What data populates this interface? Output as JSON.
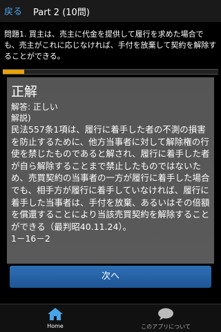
{
  "header": {
    "back_label": "戻る",
    "title": "Part 2 (10問)"
  },
  "question": {
    "text": "問題1. 買主は、売主に代金を提供して履行を求めた場合でも、売主がこれに応じなければ、手付を放棄して契約を解除することができる。"
  },
  "progress": {
    "fraction": 0.1
  },
  "result": {
    "verdict": "正解",
    "answer": "解答: 正しい",
    "explanation_label": "解説)",
    "explanation": "民法557条1項は、履行に着手した者の不測の損害を防止するために、他方当事者に対して解除権の行使を禁じたものであると解され、履行に着手した者が自ら解除することまで禁止したものではないため、売買契約の当事者の一方が履行に着手した場合でも、相手方が履行に着手していなければ、履行に着手した当事者は、手付を放棄、あるいはその倍額を償還することにより当該売買契約を解除することができる（最判昭40.11.24）。\n1－16－2"
  },
  "next_label": "次へ",
  "tabs": [
    {
      "label": "Home",
      "icon": "home-icon"
    },
    {
      "label": "このアプリについて",
      "icon": "speech-bubble-icon"
    }
  ]
}
